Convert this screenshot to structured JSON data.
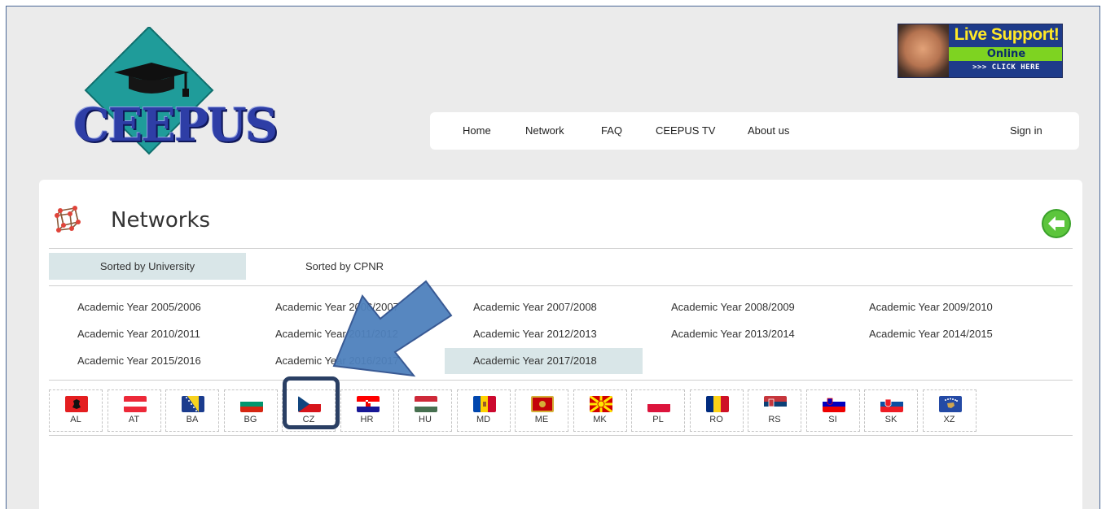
{
  "logo": {
    "text": "CEEPUS"
  },
  "live_support": {
    "title": "Live Support!",
    "status": "Online",
    "cta": ">>> CLICK HERE"
  },
  "nav": {
    "items": [
      "Home",
      "Network",
      "FAQ",
      "CEEPUS TV",
      "About us"
    ],
    "sign_in": "Sign in"
  },
  "page": {
    "title": "Networks"
  },
  "tabs": [
    {
      "label": "Sorted by University",
      "active": true
    },
    {
      "label": "Sorted by CPNR",
      "active": false
    }
  ],
  "years": [
    "Academic Year 2005/2006",
    "Academic Year 2006/2007",
    "Academic Year 2007/2008",
    "Academic Year 2008/2009",
    "Academic Year 2009/2010",
    "Academic Year 2010/2011",
    "Academic Year 2011/2012",
    "Academic Year 2012/2013",
    "Academic Year 2013/2014",
    "Academic Year 2014/2015",
    "Academic Year 2015/2016",
    "Academic Year 2016/2017",
    "Academic Year 2017/2018"
  ],
  "active_year": "Academic Year 2017/2018",
  "countries": [
    "AL",
    "AT",
    "BA",
    "BG",
    "CZ",
    "HR",
    "HU",
    "MD",
    "ME",
    "MK",
    "PL",
    "RO",
    "RS",
    "SI",
    "SK",
    "XZ"
  ],
  "highlighted_country": "CZ",
  "colors": {
    "accent": "#4f81bd",
    "highlight_border": "#2a3f64",
    "active_tab": "#d9e6e8"
  }
}
